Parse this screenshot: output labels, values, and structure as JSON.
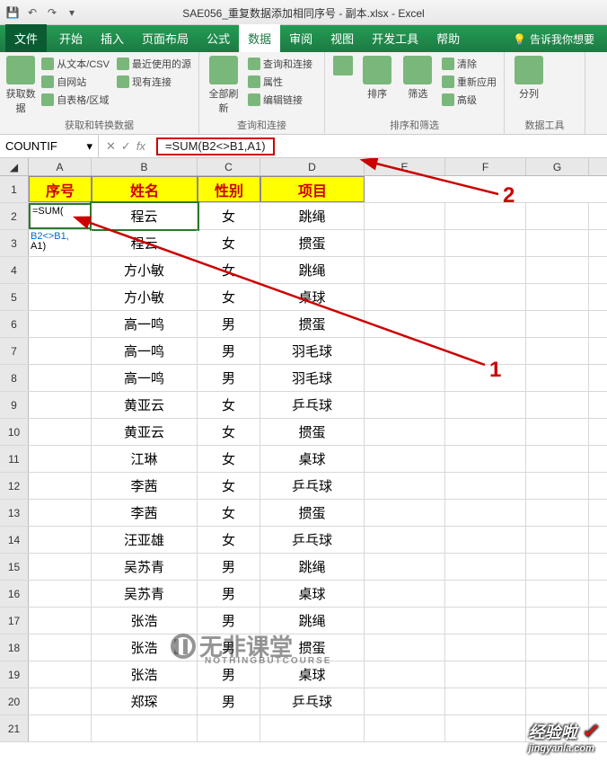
{
  "title": "SAE056_重复数据添加相同序号 - 副本.xlsx - Excel",
  "qat": {
    "save": "保存",
    "undo": "撤销",
    "redo": "重做"
  },
  "tabs": {
    "file": "文件",
    "home": "开始",
    "insert": "插入",
    "layout": "页面布局",
    "formula": "公式",
    "data": "数据",
    "review": "审阅",
    "view": "视图",
    "dev": "开发工具",
    "help": "帮助"
  },
  "tellme": "告诉我你想要",
  "ribbon": {
    "g1": {
      "big": "获取数\n据",
      "a": "从文本/CSV",
      "b": "最近使用的源",
      "c": "自网站",
      "d": "现有连接",
      "e": "自表格/区域",
      "label": "获取和转换数据"
    },
    "g2": {
      "big": "全部刷新",
      "a": "查询和连接",
      "b": "属性",
      "c": "编辑链接",
      "label": "查询和连接"
    },
    "g3": {
      "sort": "排序",
      "filter": "筛选",
      "clear": "清除",
      "reapply": "重新应用",
      "adv": "高级",
      "label": "排序和筛选"
    },
    "g4": {
      "big": "分列",
      "label": "数据工具"
    }
  },
  "namebox": "COUNTIF",
  "fx_cancel": "✕",
  "fx_enter": "✓",
  "fx_fx": "fx",
  "formula": "=SUM(B2<>B1,A1)",
  "cols": {
    "A": "A",
    "B": "B",
    "C": "C",
    "D": "D",
    "E": "E",
    "F": "F",
    "G": "G"
  },
  "hdr": {
    "A": "序号",
    "B": "姓名",
    "C": "性别",
    "D": "项目"
  },
  "cellA2": {
    "p1": "=SUM(",
    "p2": "B2<>B1,",
    "p3": "A1)"
  },
  "rows": [
    {
      "n": 2,
      "B": "程云",
      "C": "女",
      "D": "跳绳"
    },
    {
      "n": 3,
      "B": "程云",
      "C": "女",
      "D": "掼蛋"
    },
    {
      "n": 4,
      "B": "方小敏",
      "C": "女",
      "D": "跳绳"
    },
    {
      "n": 5,
      "B": "方小敏",
      "C": "女",
      "D": "桌球"
    },
    {
      "n": 6,
      "B": "高一鸣",
      "C": "男",
      "D": "掼蛋"
    },
    {
      "n": 7,
      "B": "高一鸣",
      "C": "男",
      "D": "羽毛球"
    },
    {
      "n": 8,
      "B": "高一鸣",
      "C": "男",
      "D": "羽毛球"
    },
    {
      "n": 9,
      "B": "黄亚云",
      "C": "女",
      "D": "乒乓球"
    },
    {
      "n": 10,
      "B": "黄亚云",
      "C": "女",
      "D": "掼蛋"
    },
    {
      "n": 11,
      "B": "江琳",
      "C": "女",
      "D": "桌球"
    },
    {
      "n": 12,
      "B": "李茜",
      "C": "女",
      "D": "乒乓球"
    },
    {
      "n": 13,
      "B": "李茜",
      "C": "女",
      "D": "掼蛋"
    },
    {
      "n": 14,
      "B": "汪亚雄",
      "C": "女",
      "D": "乒乓球"
    },
    {
      "n": 15,
      "B": "吴苏青",
      "C": "男",
      "D": "跳绳"
    },
    {
      "n": 16,
      "B": "吴苏青",
      "C": "男",
      "D": "桌球"
    },
    {
      "n": 17,
      "B": "张浩",
      "C": "男",
      "D": "跳绳"
    },
    {
      "n": 18,
      "B": "张浩",
      "C": "男",
      "D": "掼蛋"
    },
    {
      "n": 19,
      "B": "张浩",
      "C": "男",
      "D": "桌球"
    },
    {
      "n": 20,
      "B": "郑琛",
      "C": "男",
      "D": "乒乓球"
    }
  ],
  "row21": 21,
  "callout": {
    "one": "1",
    "two": "2"
  },
  "wm": {
    "main": "无非课堂",
    "sub": "NOTHINGBUTCOURSE"
  },
  "foot": {
    "a": "经验啦",
    "b": "jingyanla.com",
    "chk": "✓"
  }
}
